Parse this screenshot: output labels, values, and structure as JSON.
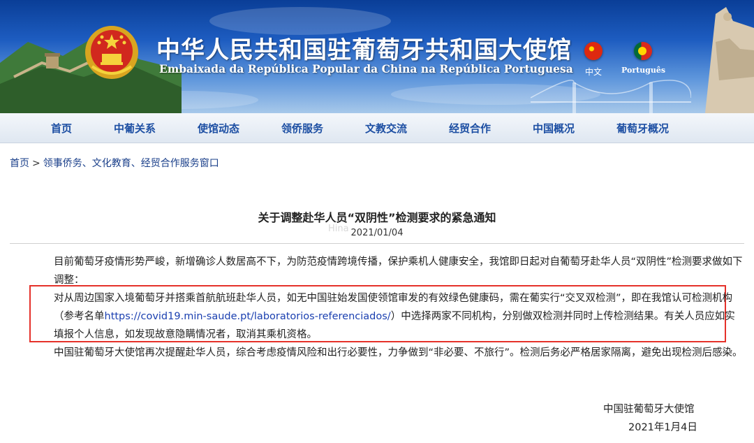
{
  "header": {
    "title_cn": "中华人民共和国驻葡萄牙共和国大使馆",
    "title_pt": "Embaixada da República Popular da China na República Portuguesa",
    "languages": [
      {
        "label": "中文",
        "flag": "china-flag-icon"
      },
      {
        "label": "Português",
        "flag": "portugal-flag-icon"
      }
    ]
  },
  "nav": {
    "items": [
      "首页",
      "中葡关系",
      "使馆动态",
      "领侨服务",
      "文教交流",
      "经贸合作",
      "中国概况",
      "葡萄牙概况"
    ]
  },
  "breadcrumb": {
    "home": "首页",
    "separator": ">",
    "current": "领事侨务、文化教育、经贸合作服务窗口"
  },
  "article": {
    "title": "关于调整赴华人员“双阴性”检测要求的紧急通知",
    "date": "2021/01/04",
    "watermark": "Hina",
    "para1": "目前葡萄牙疫情形势严峻，新增确诊人数居高不下，为防范疫情跨境传播，保护乘机人健康安全，我馆即日起对自葡萄牙赴华人员“双阴性”检测要求做如下调整：",
    "para2_before": "对从周边国家入境葡萄牙并搭乘首航航班赴华人员，如无中国驻始发国使领馆审发的有效绿色健康码，需在葡实行“交叉双检测”，即在我馆认可检测机构（参考名单",
    "para2_link": "https://covid19.min-saude.pt/laboratorios-referenciados/",
    "para2_after": "）中选择两家不同机构，分别做双检测并同时上传检测结果。有关人员应如实填报个人信息，如发现故意隐瞒情况者，取消其乘机资格。",
    "para3": "中国驻葡萄牙大使馆再次提醒赴华人员，综合考虑疫情风险和出行必要性，力争做到“非必要、不旅行”。检测后务必严格居家隔离，避免出现检测后感染。",
    "signature_org": "中国驻葡萄牙大使馆",
    "signature_date": "2021年1月4日"
  },
  "colors": {
    "banner_blue": "#1d5cc0",
    "nav_link": "#1d4fa3",
    "highlight_box": "#e5312a",
    "link": "#1a3fb0"
  }
}
